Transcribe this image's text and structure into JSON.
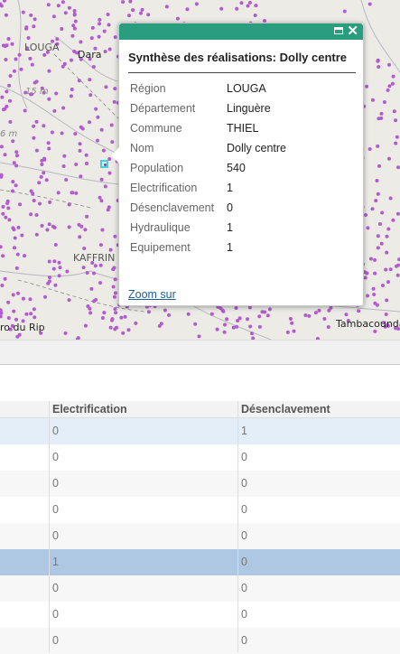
{
  "map": {
    "labels": {
      "louga": "LOUGA",
      "dara": "Dara",
      "c15m": "15 m",
      "c6m": "6 m",
      "kaffrine": "KAFFRIN",
      "rip": "ro du Rip",
      "tambacounda": "Tambacounda"
    },
    "point_color": "#b45ad0",
    "accent": "#2a9d7f"
  },
  "popup": {
    "title": "Synthèse des réalisations: Dolly centre",
    "attributes": [
      {
        "label": "Région",
        "value": "LOUGA"
      },
      {
        "label": "Département",
        "value": "Linguère"
      },
      {
        "label": "Commune",
        "value": "THIEL"
      },
      {
        "label": "Nom",
        "value": "Dolly centre"
      },
      {
        "label": "Population",
        "value": "540"
      },
      {
        "label": "Electrification",
        "value": "1"
      },
      {
        "label": "Désenclavement",
        "value": "0"
      },
      {
        "label": "Hydraulique",
        "value": "1"
      },
      {
        "label": "Equipement",
        "value": "1"
      }
    ],
    "zoom_label": "Zoom sur",
    "maximize_icon": "maximize-icon",
    "close_icon": "close-icon"
  },
  "grid": {
    "columns": [
      "Electrification",
      "Désenclavement"
    ],
    "rows": [
      {
        "electrification": "0",
        "desenclavement": "1",
        "state": "hover"
      },
      {
        "electrification": "0",
        "desenclavement": "0",
        "state": ""
      },
      {
        "electrification": "0",
        "desenclavement": "0",
        "state": "alt"
      },
      {
        "electrification": "0",
        "desenclavement": "0",
        "state": ""
      },
      {
        "electrification": "0",
        "desenclavement": "0",
        "state": "alt"
      },
      {
        "electrification": "1",
        "desenclavement": "0",
        "state": "selected"
      },
      {
        "electrification": "0",
        "desenclavement": "0",
        "state": "alt"
      },
      {
        "electrification": "0",
        "desenclavement": "0",
        "state": ""
      },
      {
        "electrification": "0",
        "desenclavement": "0",
        "state": "alt"
      }
    ]
  }
}
